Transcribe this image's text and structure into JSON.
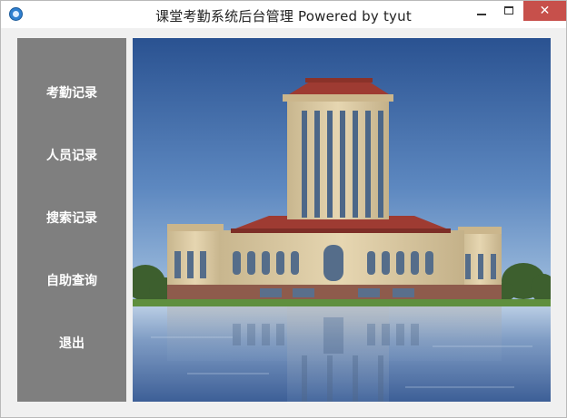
{
  "window": {
    "title": "课堂考勤系统后台管理 Powered by tyut",
    "controls": {
      "minimize_icon": "minimize-icon",
      "maximize_icon": "maximize-icon",
      "close_label": "✕"
    }
  },
  "sidebar": {
    "items": [
      {
        "label": "考勤记录"
      },
      {
        "label": "人员记录"
      },
      {
        "label": "搜索记录"
      },
      {
        "label": "自助查询"
      },
      {
        "label": "退出"
      }
    ]
  },
  "main": {
    "image": {
      "subject": "campus building with reflection in lake"
    }
  },
  "colors": {
    "sidebar_bg": "#7f7f7f",
    "sky_top": "#2a5291",
    "sky_bottom": "#8fb4d8",
    "building": "#d9c9a4",
    "roof": "#9e3b32",
    "water": "#6f8fb8",
    "close_button": "#c7504b"
  }
}
